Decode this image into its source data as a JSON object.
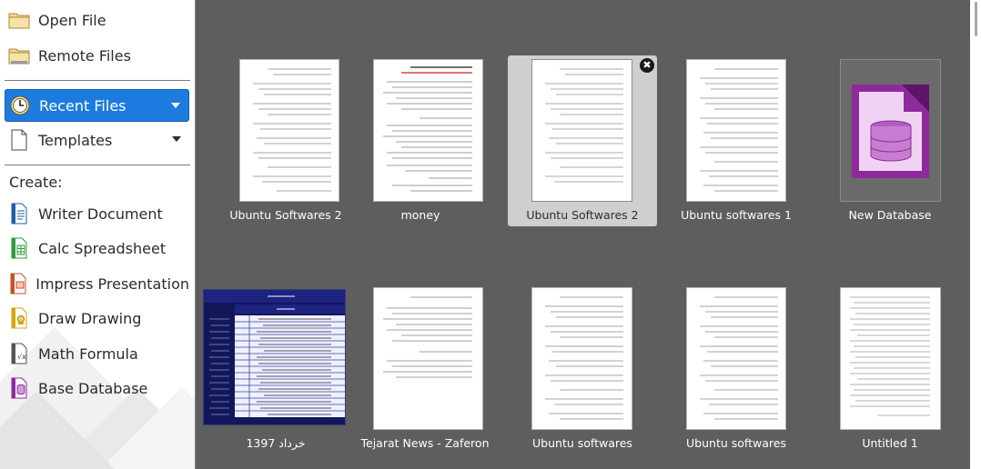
{
  "sidebar": {
    "open_file": "Open File",
    "remote_files": "Remote Files",
    "recent_files": "Recent Files",
    "templates": "Templates",
    "create_label": "Create:",
    "create_items": [
      {
        "label": "Writer Document",
        "icon": "writer-document-icon",
        "color": "#1f5da8"
      },
      {
        "label": "Calc Spreadsheet",
        "icon": "calc-spreadsheet-icon",
        "color": "#2f9b3a"
      },
      {
        "label": "Impress Presentation",
        "icon": "impress-presentation-icon",
        "color": "#c8502a"
      },
      {
        "label": "Draw Drawing",
        "icon": "draw-drawing-icon",
        "color": "#d9a40f"
      },
      {
        "label": "Math Formula",
        "icon": "math-formula-icon",
        "color": "#555555"
      },
      {
        "label": "Base Database",
        "icon": "base-database-icon",
        "color": "#8e2a9b"
      }
    ],
    "active_color": "#1d7be0"
  },
  "recent_documents": [
    {
      "title": "Ubuntu Softwares 2",
      "kind": "document"
    },
    {
      "title": "money",
      "kind": "document"
    },
    {
      "title": "Ubuntu Softwares 2",
      "kind": "document",
      "selected": true,
      "close": "✖"
    },
    {
      "title": "Ubuntu softwares 1",
      "kind": "document"
    },
    {
      "title": "New Database",
      "kind": "database"
    },
    {
      "title": "خرداد 1397",
      "kind": "spreadsheet"
    },
    {
      "title": "Tejarat News - Zaferon",
      "kind": "document"
    },
    {
      "title": "Ubuntu softwares",
      "kind": "document"
    },
    {
      "title": "Ubuntu softwares",
      "kind": "document"
    },
    {
      "title": "Untitled 1",
      "kind": "document"
    }
  ],
  "colors": {
    "main_bg": "#5e5e5e",
    "selected_tile": "#cfcfcf",
    "base_purple": "#8e2a9b"
  }
}
